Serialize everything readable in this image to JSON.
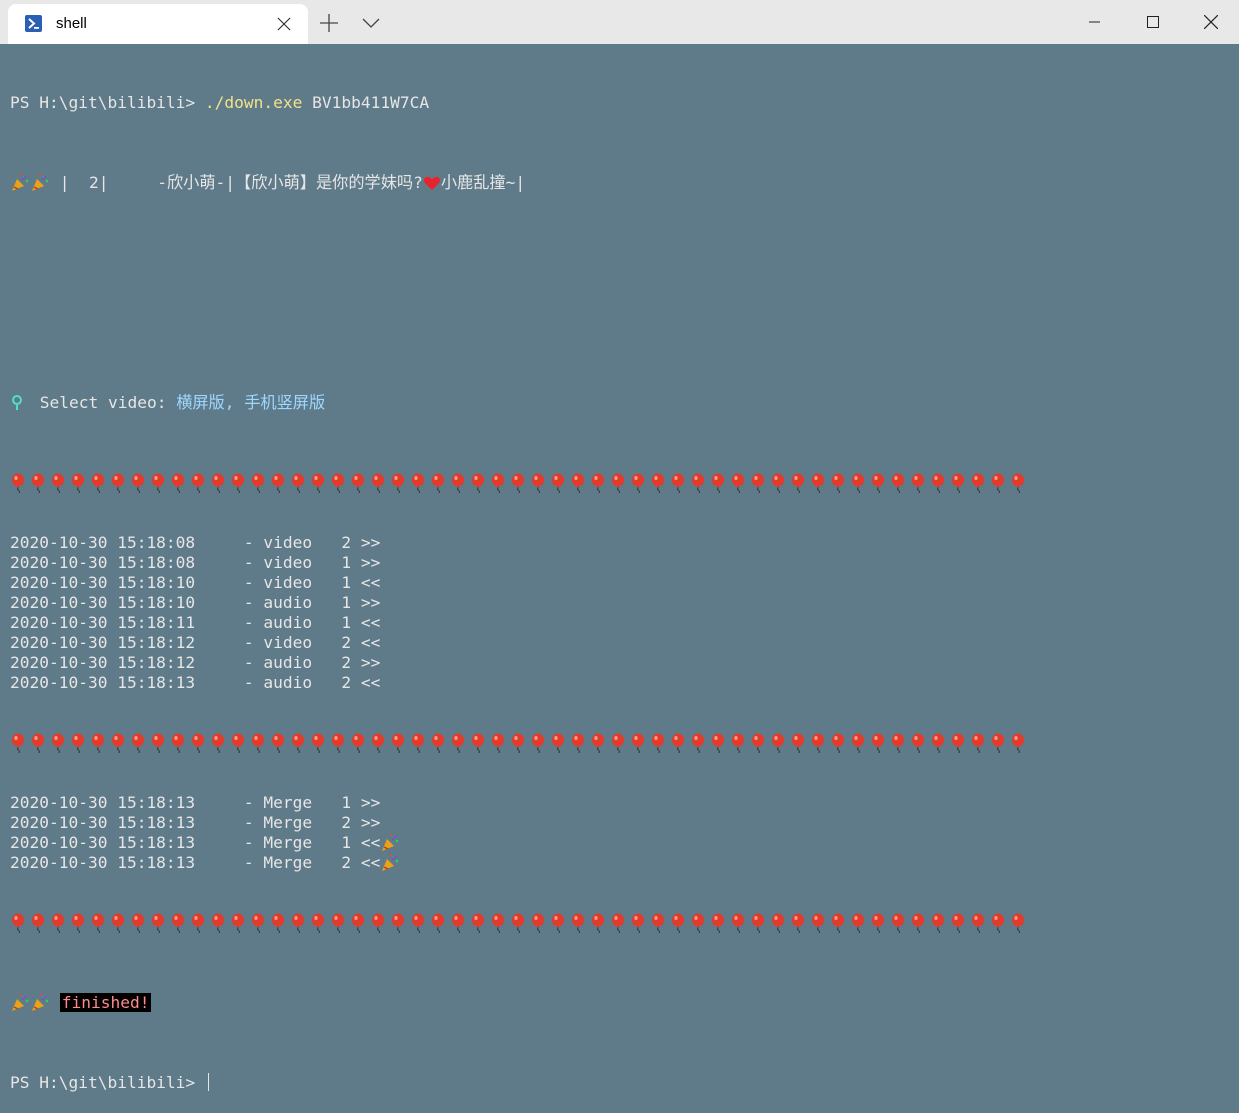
{
  "window": {
    "tab_title": "shell",
    "tab_icon": "powershell-icon",
    "colors": {
      "titlebar": "#e8e8e8",
      "terminal_bg": "#5f7a88",
      "text": "#e6e6e6",
      "command": "#f2e28a",
      "highlight": "#9fd8ff",
      "finished_fg": "#ff8a8a",
      "finished_bg": "#000000"
    }
  },
  "terminal": {
    "prompt": "PS H:\\git\\bilibili> ",
    "command": "./down.exe",
    "command_arg": " BV1bb411W7CA",
    "info_line": "|  2|     -欣小萌-|【欣小萌】是你的学妹吗?",
    "info_suffix": "小鹿乱撞~|",
    "select_label": " Select video: ",
    "select_value": "横屏版, 手机竖屏版",
    "balloon_count": 51,
    "log1": [
      "2020-10-30 15:18:08     - video   2 >>",
      "2020-10-30 15:18:08     - video   1 >>",
      "2020-10-30 15:18:10     - video   1 <<",
      "2020-10-30 15:18:10     - audio   1 >>",
      "2020-10-30 15:18:11     - audio   1 <<",
      "2020-10-30 15:18:12     - video   2 <<",
      "2020-10-30 15:18:12     - audio   2 >>",
      "2020-10-30 15:18:13     - audio   2 <<"
    ],
    "log2": [
      "2020-10-30 15:18:13     - Merge   1 >>",
      "2020-10-30 15:18:13     - Merge   2 >>",
      "2020-10-30 15:18:13     - Merge   1 <<",
      "2020-10-30 15:18:13     - Merge   2 <<"
    ],
    "finished": "finished!",
    "final_prompt": "PS H:\\git\\bilibili> "
  }
}
